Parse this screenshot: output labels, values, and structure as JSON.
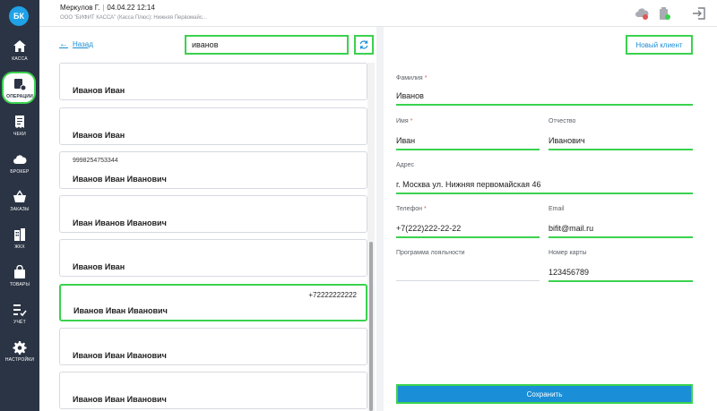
{
  "sidebar": {
    "logo": "БК",
    "items": [
      {
        "label": "КАССА",
        "icon": "home-icon"
      },
      {
        "label": "ОПЕРАЦИИ",
        "icon": "operations-icon"
      },
      {
        "label": "ЧЕКИ",
        "icon": "receipt-icon"
      },
      {
        "label": "БРОКЕР",
        "icon": "cloud-icon"
      },
      {
        "label": "ЗАКАЗЫ",
        "icon": "basket-icon"
      },
      {
        "label": "ЖКХ",
        "icon": "building-icon"
      },
      {
        "label": "ТОВАРЫ",
        "icon": "bag-icon"
      },
      {
        "label": "УЧЁТ",
        "icon": "checklist-icon"
      },
      {
        "label": "НАСТРОЙКИ",
        "icon": "gear-icon"
      }
    ]
  },
  "topbar": {
    "user": "Меркулов Г.",
    "datetime": "04.04.22 12:14",
    "org": "ООО \"БИФИТ КАССА\" (Касса Плюс): Нижняя Первомайс..."
  },
  "left": {
    "back_label": "Назад",
    "search_value": "иванов",
    "clients": [
      {
        "name": "Иванов Иван",
        "phone": "",
        "phone_right": ""
      },
      {
        "name": "Иванов Иван",
        "phone": "",
        "phone_right": ""
      },
      {
        "name": "Иванов Иван Иванович",
        "phone": "9998254753344",
        "phone_right": ""
      },
      {
        "name": "Иван Иванов Иванович",
        "phone": "",
        "phone_right": ""
      },
      {
        "name": "Иванов Иван",
        "phone": "",
        "phone_right": ""
      },
      {
        "name": "Иванов Иван Иванович",
        "phone": "",
        "phone_right": "+72222222222"
      },
      {
        "name": "Иванов Иван Иванович",
        "phone": "",
        "phone_right": ""
      },
      {
        "name": "Иванов Иван Иванович",
        "phone": "",
        "phone_right": ""
      }
    ]
  },
  "right": {
    "new_client_label": "Новый клиент",
    "surname_label": "Фамилия",
    "surname_value": "Иванов",
    "name_label": "Имя",
    "name_value": "Иван",
    "patronymic_label": "Отчество",
    "patronymic_value": "Иванович",
    "address_label": "Адрес",
    "address_value": "г. Москва ул. Нижняя первомайская 46",
    "phone_label": "Телефон",
    "phone_value": "+7(222)222-22-22",
    "email_label": "Email",
    "email_value": "bifit@mail.ru",
    "loyalty_label": "Программа лояльности",
    "loyalty_value": "",
    "card_label": "Номер карты",
    "card_value": "123456789",
    "required_mark": "*",
    "save_label": "Сохранить"
  },
  "colors": {
    "accent": "#1a8ed6",
    "highlight": "#3ad24e",
    "sidebar": "#2b3444"
  }
}
